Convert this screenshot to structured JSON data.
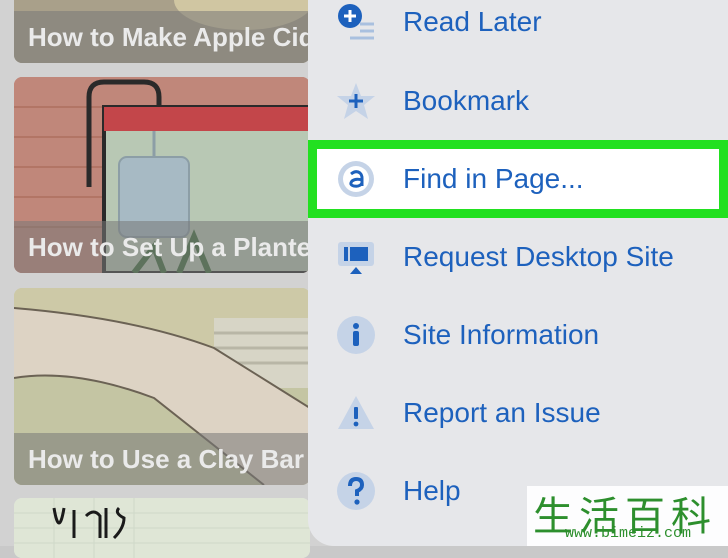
{
  "articles": [
    {
      "title": "How to Make Apple Cider Vinegar"
    },
    {
      "title": "How to Set Up a Planted Aquarium"
    },
    {
      "title": "How to Use a Clay Bar"
    }
  ],
  "menu": {
    "items": [
      {
        "label": "Read Later",
        "icon": "read-later-icon"
      },
      {
        "label": "Bookmark",
        "icon": "bookmark-star-icon"
      },
      {
        "label": "Find in Page...",
        "icon": "find-in-page-icon",
        "highlighted": true
      },
      {
        "label": "Request Desktop Site",
        "icon": "desktop-icon"
      },
      {
        "label": "Site Information",
        "icon": "info-icon"
      },
      {
        "label": "Report an Issue",
        "icon": "warning-icon"
      },
      {
        "label": "Help",
        "icon": "help-icon"
      }
    ],
    "accent_color": "#1d61bd",
    "highlight_color": "#22e020"
  },
  "watermark": {
    "chinese": "生活百科",
    "url": "www.bimeiz.com"
  }
}
